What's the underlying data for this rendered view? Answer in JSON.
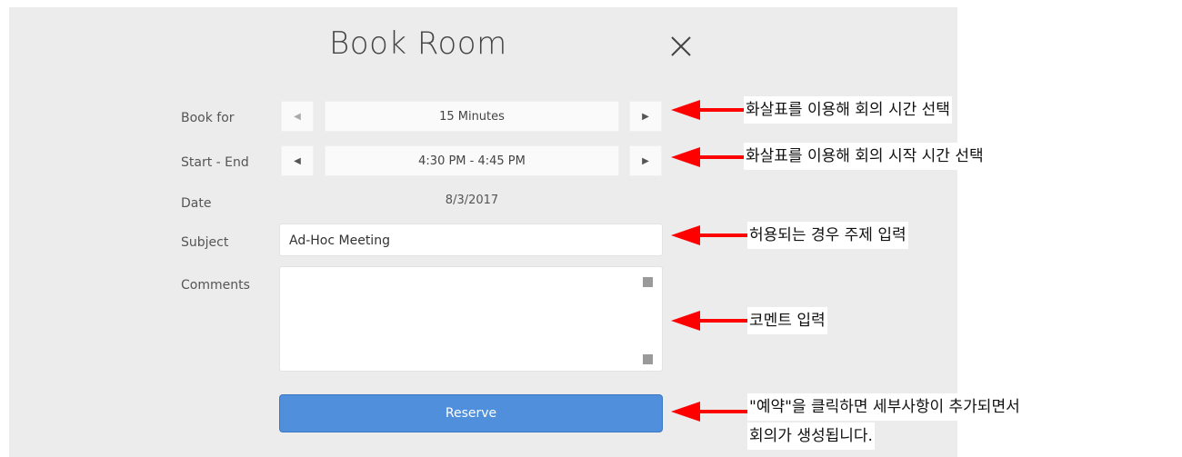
{
  "dialog": {
    "title": "Book Room",
    "close_icon": "close-icon"
  },
  "fields": {
    "book_for": {
      "label": "Book for",
      "value": "15 Minutes"
    },
    "start_end": {
      "label": "Start - End",
      "value": "4:30 PM - 4:45 PM"
    },
    "date": {
      "label": "Date",
      "value": "8/3/2017"
    },
    "subject": {
      "label": "Subject",
      "value": "Ad-Hoc Meeting"
    },
    "comments": {
      "label": "Comments",
      "value": ""
    }
  },
  "reserve_label": "Reserve",
  "annotations": {
    "book_for": "화살표를 이용해 회의 시간 선택",
    "start_end": "화살표를 이용해 회의 시작 시간 선택",
    "subject": "허용되는 경우 주제 입력",
    "comments": "코멘트 입력",
    "reserve_line1": "\"예약\"을 클릭하면 세부사항이 추가되면서",
    "reserve_line2": "회의가 생성됩니다."
  },
  "colors": {
    "accent_button": "#4f8fdc",
    "annotation_arrow": "#ff0000",
    "panel_bg": "#ececec"
  }
}
